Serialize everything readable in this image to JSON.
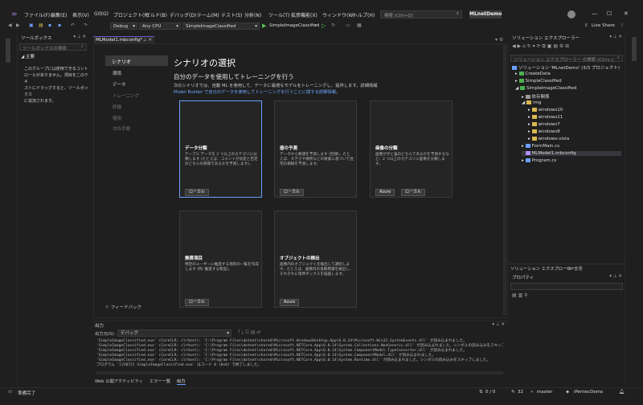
{
  "app": {
    "menu": [
      "ファイル(F)",
      "編集(E)",
      "表示(V)",
      "Git(G)",
      "プロジェクト(P)",
      "ビルド(B)",
      "デバッグ(D)",
      "テーム(M)",
      "テスト(S)",
      "分析(N)",
      "ツール(T)",
      "拡張機能(X)",
      "ウィンドウ(W)",
      "ヘルプ(H)"
    ],
    "search_placeholder": "検索 (Ctrl+Q)",
    "solution_badge": "MLnetDemo",
    "live_share": "Live Share"
  },
  "toolbar": {
    "config": "Debug",
    "platform": "Any CPU",
    "project": "SimpleImageClassified",
    "run_label": "SimpleImageClassified"
  },
  "toolbox": {
    "title": "ツールボックス",
    "search_placeholder": "ツールボックスの検索",
    "group": "主要",
    "empty_message": [
      "このグループには使用できるコント",
      "ロールがありません。項目をこのテキ",
      "ストにドラッグすると、ツールボックス",
      "に追加されます。"
    ]
  },
  "doc": {
    "tab": "MLModel1.mbconfig*",
    "nav_active": "シナリオ",
    "nav": [
      "環境",
      "データ"
    ],
    "nav_dim": [
      "トレーニング",
      "評価",
      "使用",
      "次の手順"
    ],
    "feedback": "フィードバック",
    "title": "シナリオの選択",
    "subtitle": "自分のデータを使用してトレーニングを行う",
    "desc": "次のシナリオでは、自動 ML を使用して、データに最適なモデルをトレーニングし、提供します。詳細情報",
    "link": "Model Builder で自分のデータを使用してトレーニングを行うことに関する詳細情報。",
    "cards": [
      {
        "title": "データ分類",
        "desc": "テーブル データを 2 つ以上のカテゴリに分類します (たとえば、コメントが肯定と否定のどちらの感情であるかを予測します)。",
        "pills": [
          "ローカル"
        ]
      },
      {
        "title": "値の予測",
        "desc": "データから数値を予測します (回帰)。たとえば、大きさや場所などの要素に基づいて住宅の価格を予測します。",
        "pills": [
          "ローカル"
        ]
      },
      {
        "title": "画像の分類",
        "desc": "画像が犬と猫のどちらであるかを予測するなど、2 つ以上のカテゴリに画像を分類します。",
        "pills": [
          "Azure",
          "ローカル"
        ]
      },
      {
        "title": "推奨項目",
        "desc": "特定のユーザーに推奨する項目の一覧を作成します (例: 推奨する製品)。",
        "pills": [
          "ローカル"
        ]
      },
      {
        "title": "オブジェクトの検出",
        "desc": "画像内のオブジェクトを検出して識別します。たとえば、画像内の道路標識を検出し、それぞれに境界ボックスを描画します。",
        "pills": [
          "Azure"
        ]
      }
    ]
  },
  "solution_explorer": {
    "title": "ソリューション エクスプローラー",
    "search_placeholder": "ソリューション エクスプローラー の検索 (Ctrl+;)",
    "items": [
      "ソリューション 'MLnetDemo' (3/3 プロジェクト)",
      "CreateData",
      "SimpleClassified",
      "SimpleImageClassified",
      "依存関係",
      "img",
      "windows10",
      "windows11",
      "windows7",
      "windows8",
      "windows-vista",
      "FormMain.cs",
      "MLModel1.mbconfig",
      "Program.cs"
    ],
    "tabs": [
      "ソリューション エクスプローラー",
      "Git 変更"
    ]
  },
  "properties": {
    "title": "プロパティ"
  },
  "output": {
    "title": "出力",
    "source_label": "出力元(S):",
    "source_value": "デバッグ",
    "lines": [
      "'SimpleImageClassified.exe' (CoreCLR: clrhost): 'C:\\Program Files\\dotnet\\shared\\Microsoft.WindowsDesktop.App\\6.0.14\\Microsoft.Win32.SystemEvents.dll' が読み込まれました。",
      "'SimpleImageClassified.exe' (CoreCLR: clrhost): 'C:\\Program Files\\dotnet\\shared\\Microsoft.NETCore.App\\6.0.14\\System.Collections.NonGeneric.dll' が読み込まれました。シンボルの読み込みをスキップしました。",
      "'SimpleImageClassified.exe' (CoreCLR: clrhost): 'C:\\Program Files\\dotnet\\shared\\Microsoft.NETCore.App\\6.0.14\\System.ComponentModel.TypeConverter.dll' が読み込まれました。",
      "'SimpleImageClassified.exe' (CoreCLR: clrhost): 'C:\\Program Files\\dotnet\\shared\\Microsoft.NETCore.App\\6.0.14\\System.ComponentModel.dll' が読み込まれました。",
      "'SimpleImageClassified.exe' (CoreCLR: clrhost): 'C:\\Program Files\\dotnet\\shared\\Microsoft.NETCore.App\\6.0.14\\System.Runtime.dll' が読み込まれました。シンボルの読み込みをスキップしました。",
      "プログラム '[23072] SimpleImageClassified.exe' はコード 0 (0x0) で終了しました。"
    ],
    "bottom_tabs": [
      "Web 公開アクティビティ",
      "エラー一覧",
      "出力"
    ]
  },
  "status": {
    "left": "準備完了",
    "lines": "0 / 0",
    "count": "32",
    "branch": "master",
    "repo": "iPentecDemo"
  },
  "colors": {
    "accent": "#6aa0ff",
    "link": "#6fa8ff",
    "bg": "#1f1f1f"
  }
}
